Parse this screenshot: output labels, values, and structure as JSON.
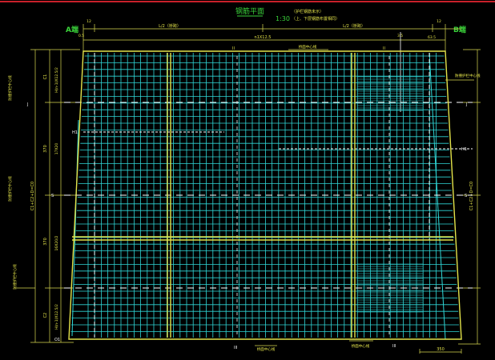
{
  "title": {
    "main": "钢筋平面",
    "scale": "1:30",
    "note1": "（护栏钢筋未示）",
    "note2": "（上、下层钢筋布置相同）"
  },
  "ends": {
    "left": "A端",
    "right": "B端"
  },
  "top_dims": {
    "half_left": "L/2（桥跨）",
    "half_right": "L/2（桥跨）",
    "mid": "n1X12.5",
    "small_left": "12",
    "small_right": "12",
    "corner_left": "0.5",
    "corner_right": "63.5",
    "right_small": "3.5"
  },
  "side_dims": {
    "left_total": "C1+C2+D=C0",
    "right_total": "C1+C2+D=C0",
    "left_seg1": "C1",
    "left_seg2": "370",
    "left_seg3": "370",
    "left_seg4": "C2",
    "left_txt1": "H(n-1)X12.5/2",
    "left_txt2": "17X20",
    "left_txt3": "16X20/2",
    "left_txt4": "H(n-1)X12.5/2"
  },
  "markers": {
    "h1_left": "H1",
    "h1_right": "H1",
    "s_left": "S",
    "s_right": "S",
    "j_left": "J",
    "j_right": "J",
    "bottom_left": "O1",
    "bottom_mid": "III",
    "bottom_right": "III",
    "top_mid_left": "II",
    "top_mid_right": "II",
    "bottom_dim": "350"
  },
  "leaders": {
    "edge_line_left1": "防撞护栏中心线",
    "edge_line_left2": "防撞护栏中心线",
    "edge_line_right": "防撞护栏中心线",
    "top_leader": "桥面中心线",
    "bottom_leader1": "桥面中心线",
    "bottom_leader2": "桥面中心线"
  },
  "colors": {
    "frame": "#e3e34a",
    "mesh": "#2fd6d6",
    "title": "#3ad23a",
    "white": "#ffffff",
    "dim": "#d8d850",
    "border": "#c8202a"
  }
}
